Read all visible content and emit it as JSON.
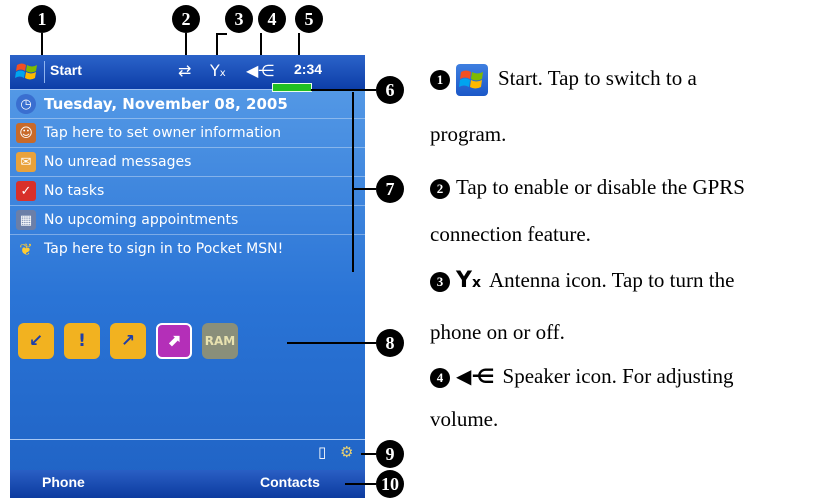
{
  "device": {
    "nav": {
      "start_label": "Start",
      "time": "2:34"
    },
    "today": {
      "date": "Tuesday, November 08, 2005",
      "owner": "Tap here to set owner information",
      "messages": "No unread messages",
      "tasks": "No tasks",
      "appointments": "No upcoming appointments",
      "msn": "Tap here to sign in to Pocket MSN!"
    },
    "menu": {
      "left": "Phone",
      "right": "Contacts"
    }
  },
  "callouts": [
    "1",
    "2",
    "3",
    "4",
    "5",
    "6",
    "7",
    "8",
    "9",
    "10"
  ],
  "descriptions": {
    "d1_line1": "Start. Tap to switch to a",
    "d1_line2": "program.",
    "d2_line1": "Tap to enable or disable the GPRS",
    "d2_line2": "connection feature.",
    "d3_line1": "Antenna icon. Tap to turn the",
    "d3_line2": "phone on or off.",
    "d4_line1": "Speaker icon. For adjusting",
    "d4_line2": "volume."
  },
  "icons": [
    "windows-flag-icon",
    "gprs-icon",
    "antenna-icon",
    "speaker-icon",
    "battery-icon",
    "calendar-icon",
    "owner-icon",
    "messages-icon",
    "tasks-icon",
    "appointments-icon",
    "msn-butterfly-icon"
  ],
  "colors": {
    "screen_top": "#5a9ee8",
    "screen_bottom": "#1f62c4",
    "navbar": "#0d3ea8",
    "battery": "#20c020"
  }
}
